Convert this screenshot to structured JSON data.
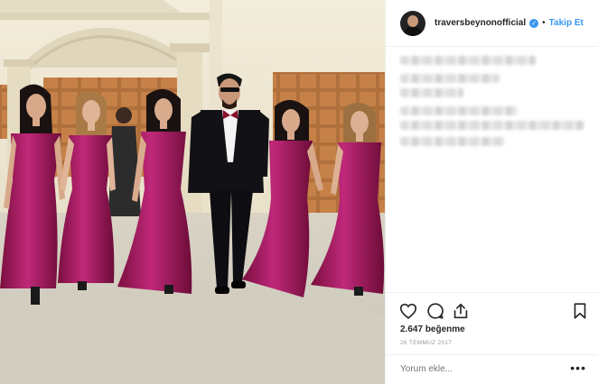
{
  "post": {
    "username": "traversbeynonofficial",
    "verified_mark": "✓",
    "separator": "•",
    "follow_label": "Takip Et",
    "likes_count": "2.647",
    "likes_word": "beğenme",
    "date": "26 TEMMUZ 2017",
    "comment_placeholder": "Yorum ekle...",
    "more_label": "•••"
  },
  "icons": {
    "like": "heart-icon",
    "comment": "comment-bubble-icon",
    "share": "share-icon",
    "save": "bookmark-icon",
    "verified": "verified-badge-icon",
    "more": "more-options-icon"
  },
  "colors": {
    "accent": "#3897f0",
    "text": "#262626",
    "muted": "#999999",
    "divider": "#efefef",
    "dress": "#a01c5a",
    "suit": "#121216"
  }
}
